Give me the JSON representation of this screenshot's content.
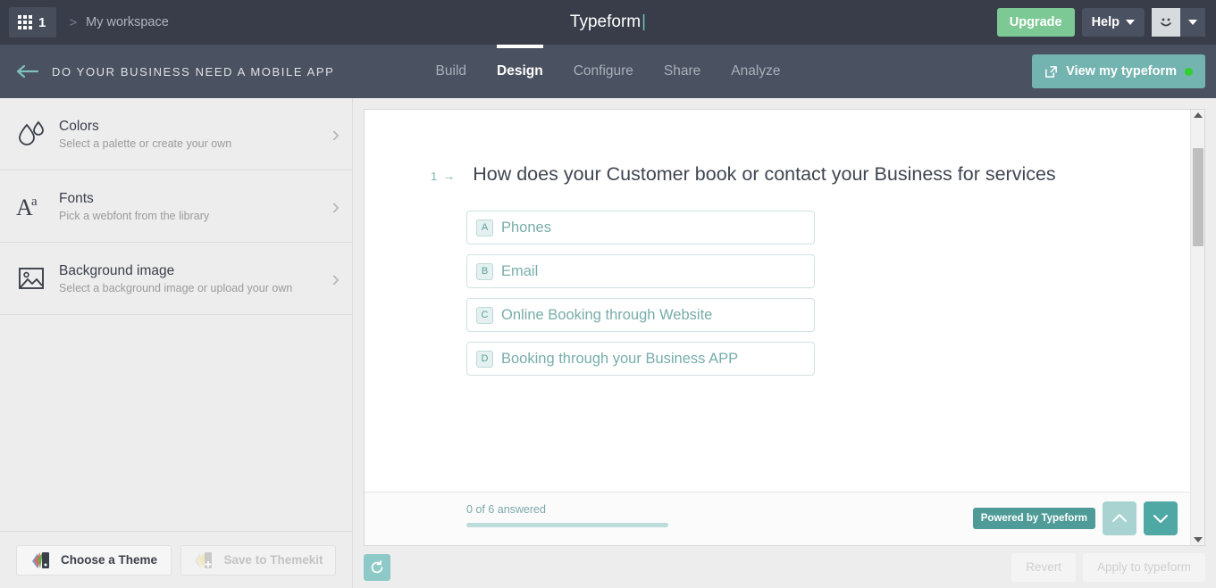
{
  "topbar": {
    "workspace_count": "1",
    "breadcrumb_separator": ">",
    "workspace_label": "My workspace",
    "form_title": "Typeform",
    "upgrade_label": "Upgrade",
    "help_label": "Help"
  },
  "navbar": {
    "doc_title": "DO YOUR BUSINESS NEED A MOBILE APP",
    "tabs": [
      {
        "label": "Build",
        "active": false
      },
      {
        "label": "Design",
        "active": true
      },
      {
        "label": "Configure",
        "active": false
      },
      {
        "label": "Share",
        "active": false
      },
      {
        "label": "Analyze",
        "active": false
      }
    ],
    "view_typeform_label": "View my typeform"
  },
  "sidebar": {
    "items": [
      {
        "title": "Colors",
        "subtitle": "Select a palette or create your own",
        "icon": "droplets-icon"
      },
      {
        "title": "Fonts",
        "subtitle": "Pick a webfont from the library",
        "icon": "typography-icon"
      },
      {
        "title": "Background image",
        "subtitle": "Select a background image or upload your own",
        "icon": "image-icon"
      }
    ],
    "footer": {
      "choose_theme_label": "Choose a Theme",
      "save_themekit_label": "Save to Themekit"
    }
  },
  "preview": {
    "question_number": "1",
    "question_arrow": "→",
    "question_text": "How does your Customer book or contact your Business for services",
    "options": [
      {
        "key": "A",
        "label": "Phones"
      },
      {
        "key": "B",
        "label": "Email"
      },
      {
        "key": "C",
        "label": "Online Booking through Website"
      },
      {
        "key": "D",
        "label": "Booking through your Business APP"
      }
    ],
    "progress_label": "0 of 6 answered",
    "progress_percent": 0,
    "powered_label": "Powered by Typeform"
  },
  "bottom_bar": {
    "revert_label": "Revert",
    "apply_label": "Apply to typeform"
  },
  "colors": {
    "topbar_bg": "#383d49",
    "navbar_bg": "#4a5160",
    "accent_teal": "#4fa8a4",
    "upgrade_green": "#7dc995",
    "status_dot": "#2ed12e",
    "option_text": "#78adaa"
  }
}
